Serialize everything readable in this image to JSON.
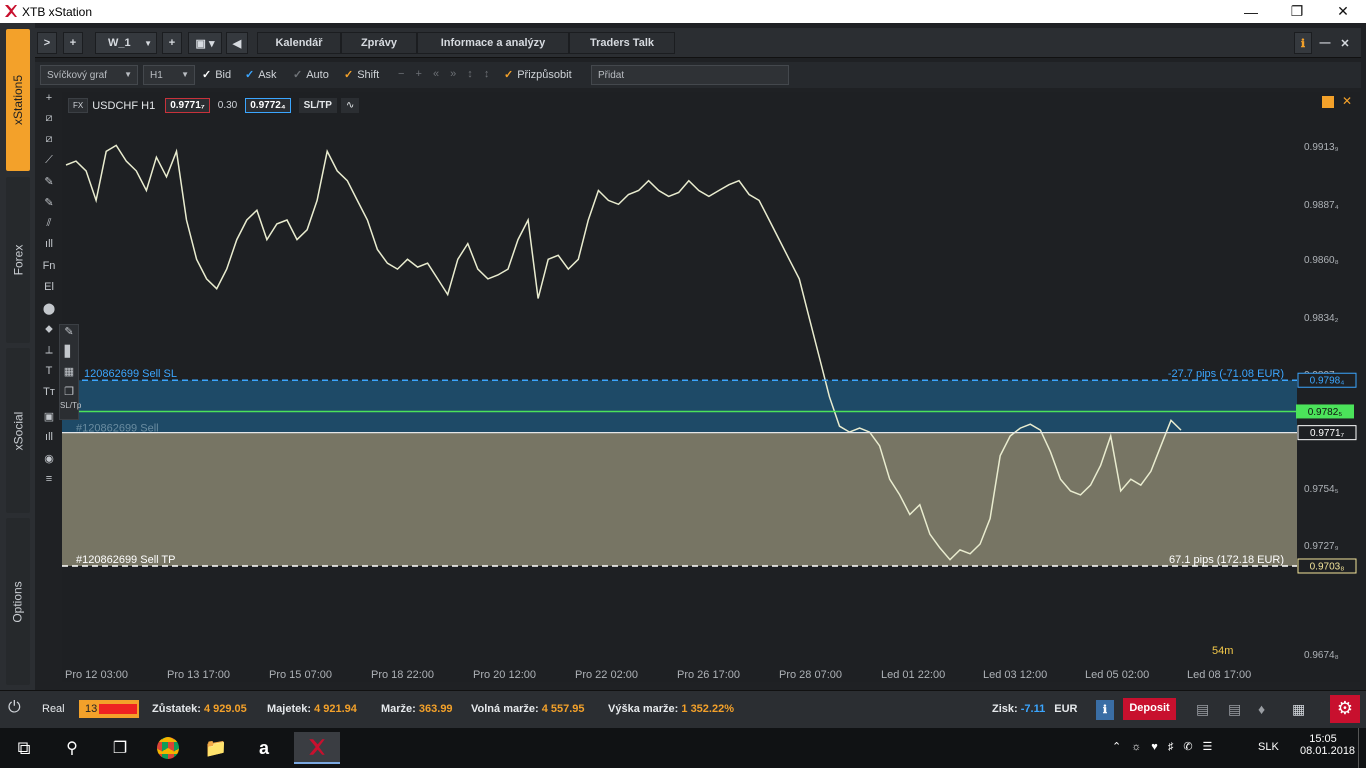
{
  "window": {
    "title": "XTB xStation"
  },
  "side_tabs": [
    "xStation5",
    "Forex",
    "xSocial",
    "Options"
  ],
  "topbar": {
    "nav_next": ">",
    "nav_add": "+",
    "workspace": "W_1",
    "add_tab": "+",
    "back_arrow": "◀",
    "tabs": [
      "Kalendář",
      "Zprávy",
      "Informace a analýzy",
      "Traders Talk"
    ]
  },
  "toolbar": {
    "chart_type": "Svíčkový graf",
    "timeframe": "H1",
    "checks": [
      {
        "label": "Bid",
        "checked": true,
        "color": "#3ba6ff"
      },
      {
        "label": "Ask",
        "checked": true,
        "color": "#3ba6ff"
      },
      {
        "label": "Auto",
        "checked": false,
        "color": "#8a8e93"
      },
      {
        "label": "Shift",
        "checked": true,
        "color": "#f3a12a"
      }
    ],
    "fit_label": "Přizpůsobit",
    "add_placeholder": "Přidat"
  },
  "left_tools": [
    "+",
    "⧄",
    "⧄",
    "⟋",
    "✎",
    "✎",
    "⫽",
    "ıll",
    "Fn",
    "El",
    "⬤",
    "⬥",
    "⟂",
    "T",
    "Tт",
    "▣",
    "ıll",
    "◉",
    "≡"
  ],
  "instrument": {
    "badge": "FX",
    "symbol": "USDCHF H1",
    "bid": "0.9771₇",
    "spread": "0.30",
    "ask": "0.9772₄",
    "sltp": "SL/TP"
  },
  "chart_data": {
    "type": "line",
    "title": "USDCHF H1",
    "x_ticks": [
      "Pro 12 03:00",
      "Pro 13 17:00",
      "Pro 15 07:00",
      "Pro 18 22:00",
      "Pro 20 12:00",
      "Pro 22 02:00",
      "Pro 26 17:00",
      "Pro 28 07:00",
      "Led 01 22:00",
      "Led 03 12:00",
      "Led 05 02:00",
      "Led 08 17:00"
    ],
    "y_ticks": [
      "0.9913₉",
      "0.9887₄",
      "0.9860₈",
      "0.9834₂",
      "0.9807₆",
      "0.9754₅",
      "0.9727₉",
      "0.9674₈"
    ],
    "ylim": [
      0.966,
      0.9935
    ],
    "series": [
      {
        "values": [
          0.9908,
          0.991,
          0.9905,
          0.989,
          0.9915,
          0.9918,
          0.991,
          0.9905,
          0.9895,
          0.9912,
          0.9902,
          0.9915,
          0.988,
          0.986,
          0.985,
          0.9845,
          0.9855,
          0.987,
          0.988,
          0.9885,
          0.987,
          0.9878,
          0.988,
          0.987,
          0.9875,
          0.989,
          0.9915,
          0.9905,
          0.99,
          0.989,
          0.988,
          0.9865,
          0.9858,
          0.9855,
          0.986,
          0.9856,
          0.9858,
          0.985,
          0.9842,
          0.986,
          0.9868,
          0.9855,
          0.985,
          0.9852,
          0.9855,
          0.987,
          0.988,
          0.984,
          0.986,
          0.9862,
          0.9855,
          0.986,
          0.988,
          0.9895,
          0.989,
          0.9888,
          0.9893,
          0.9895,
          0.99,
          0.9895,
          0.9892,
          0.9894,
          0.99,
          0.9895,
          0.9892,
          0.9895,
          0.9898,
          0.99,
          0.9893,
          0.989,
          0.988,
          0.987,
          0.986,
          0.985,
          0.983,
          0.981,
          0.979,
          0.9775,
          0.9772,
          0.9774,
          0.9772,
          0.9765,
          0.9748,
          0.974,
          0.973,
          0.9735,
          0.972,
          0.9713,
          0.9707,
          0.9712,
          0.971,
          0.9715,
          0.9728,
          0.976,
          0.977,
          0.9774,
          0.9776,
          0.9773,
          0.9762,
          0.9748,
          0.9742,
          0.974,
          0.9745,
          0.9755,
          0.977,
          0.9742,
          0.9748,
          0.9745,
          0.9752,
          0.9765,
          0.9778,
          0.9773
        ]
      }
    ]
  },
  "order_lines": {
    "sl": {
      "label": "120862699 Sell  SL",
      "pips": "-27.7 pips (-71.08 EUR)",
      "price": "0.9798₄",
      "value": 0.97984
    },
    "current": {
      "price": "0.9782₅",
      "value": 0.97825
    },
    "entry": {
      "label": "#120862699 Sell",
      "price": "0.9771₇",
      "value": 0.97717
    },
    "tp": {
      "label": "#120862699 Sell  TP",
      "pips": "67.1 pips (172.18 EUR)",
      "price": "0.9703₈",
      "value": 0.97038
    }
  },
  "candle_timer": "54m",
  "bottombar": {
    "account_type": "Real",
    "account_id": "13",
    "balance_label": "Zůstatek:",
    "balance": "4 929.05",
    "equity_label": "Majetek:",
    "equity": "4 921.94",
    "margin_label": "Marže:",
    "margin": "363.99",
    "free_margin_label": "Volná marže:",
    "free_margin": "4 557.95",
    "margin_level_label": "Výška marže:",
    "margin_level": "1 352.22%",
    "profit_label": "Zisk:",
    "profit": "-7.11",
    "currency": "EUR",
    "deposit": "Deposit"
  },
  "taskbar": {
    "time": "15:05",
    "date": "08.01.2018",
    "lang": "SLK"
  }
}
